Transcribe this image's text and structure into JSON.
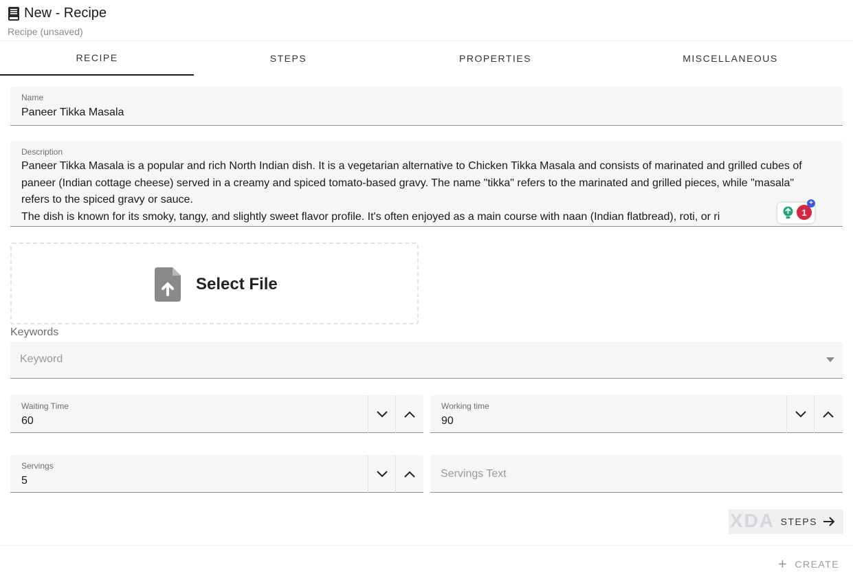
{
  "header": {
    "title": "New - Recipe",
    "subtitle": "Recipe (unsaved)"
  },
  "tabs": [
    {
      "label": "RECIPE",
      "active": true
    },
    {
      "label": "STEPS",
      "active": false
    },
    {
      "label": "PROPERTIES",
      "active": false
    },
    {
      "label": "MISCELLANEOUS",
      "active": false
    }
  ],
  "form": {
    "name": {
      "label": "Name",
      "value": "Paneer Tikka Masala"
    },
    "description": {
      "label": "Description",
      "value": "Paneer Tikka Masala is a popular and rich North Indian dish. It is a vegetarian alternative to Chicken Tikka Masala and consists of marinated and grilled cubes of paneer (Indian cottage cheese) served in a creamy and spiced tomato-based gravy. The name \"tikka\" refers to the marinated and grilled pieces, while \"masala\" refers to the spiced gravy or sauce.\nThe dish is known for its smoky, tangy, and slightly sweet flavor profile. It's often enjoyed as a main course with naan (Indian flatbread), roti, or ri"
    },
    "extension_badge": {
      "count": "1",
      "plus": "+"
    },
    "file": {
      "label": "Select File"
    },
    "keywords": {
      "section_label": "Keywords",
      "placeholder": "Keyword"
    },
    "waiting_time": {
      "label": "Waiting Time",
      "value": "60"
    },
    "working_time": {
      "label": "Working time",
      "value": "90"
    },
    "servings": {
      "label": "Servings",
      "value": "5"
    },
    "servings_text": {
      "placeholder": "Servings Text"
    }
  },
  "actions": {
    "steps_label": "STEPS",
    "create_label": "CREATE",
    "watermark": "XDA"
  },
  "colors": {
    "field_bg": "#f6f6f6",
    "accent_red": "#d62640",
    "accent_green": "#1ba672",
    "accent_blue": "#3b5ce6"
  }
}
